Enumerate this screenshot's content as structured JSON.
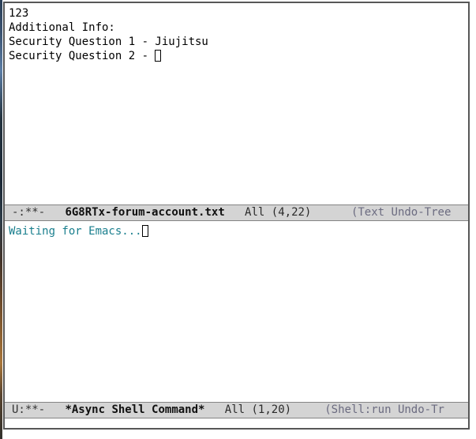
{
  "frame": {
    "app": "GNU Emacs",
    "border_color": "#575757",
    "background": "#ffffff"
  },
  "windows": [
    {
      "id": "file-buffer",
      "buffer_text_lines": [
        "123",
        "Additional Info:",
        "Security Question 1 - Jiujitsu",
        "Security Question 2 - "
      ],
      "cursor_line_index": 3,
      "mode_line": {
        "flags": "-:**-",
        "buffer_name": "6G8RTx-forum-account.txt",
        "position_indicator": "All",
        "point_position": "(4,22)",
        "major_modes": "(Text Undo-Tree",
        "truncated_at_right": true,
        "background": "#d4d4d4",
        "text_color": "#101010"
      }
    },
    {
      "id": "async-shell-command",
      "buffer_text_lines": [
        "Waiting for Emacs..."
      ],
      "buffer_text_color": "#1a7f8e",
      "cursor_line_index": 0,
      "mode_line": {
        "flags": "U:**-",
        "buffer_name": "*Async Shell Command*",
        "position_indicator": "All",
        "point_position": "(1,20)",
        "major_modes": "(Shell:run Undo-Tr",
        "truncated_at_right": true,
        "background": "#d4d4d4",
        "text_color": "#101010"
      }
    }
  ]
}
